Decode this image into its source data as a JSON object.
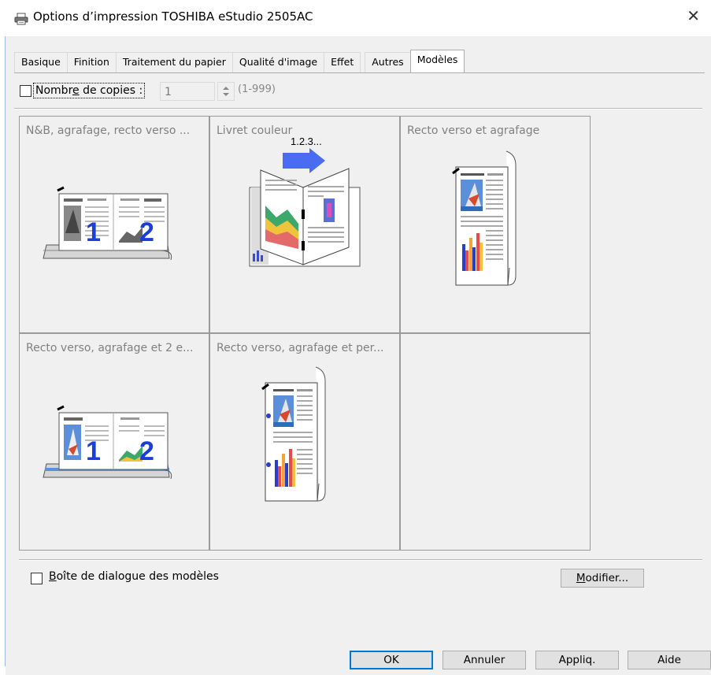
{
  "window": {
    "title": "Options d’impression TOSHIBA eStudio 2505AC",
    "close_glyph": "✕",
    "icon": "printer-icon"
  },
  "tabs": [
    {
      "label": "Basique",
      "active": false
    },
    {
      "label": "Finition",
      "active": false
    },
    {
      "label": "Traitement du papier",
      "active": false
    },
    {
      "label": "Qualité d'image",
      "active": false
    },
    {
      "label": "Effet",
      "active": false
    },
    {
      "label": "Autres",
      "active": false
    },
    {
      "label": "Modèles",
      "active": true
    }
  ],
  "copies": {
    "label_pre": "Nombr",
    "label_accel": "e",
    "label_post": " de copies :",
    "value": "1",
    "range": "(1-999)",
    "checked": false,
    "enabled": false
  },
  "templates": [
    {
      "label": "N&B, agrafage, recto verso ...",
      "icon": "bw-staple-duplex-icon"
    },
    {
      "label": "Livret couleur",
      "icon": "color-booklet-icon",
      "overlay": "1.2.3..."
    },
    {
      "label": "Recto verso et agrafage",
      "icon": "duplex-staple-icon"
    },
    {
      "label": "Recto verso, agrafage et 2 e...",
      "icon": "duplex-staple-2up-icon"
    },
    {
      "label": "Recto verso, agrafage et per...",
      "icon": "duplex-staple-punch-icon"
    },
    {
      "label": "",
      "icon": ""
    }
  ],
  "templates_dialog": {
    "label_accel": "B",
    "label_post": "oîte de dialogue des modèles",
    "checked": false
  },
  "modify_button": {
    "label_accel": "M",
    "label_post": "odifier..."
  },
  "footer": {
    "ok": "OK",
    "cancel": "Annuler",
    "apply": "Appliq.",
    "help": "Aide"
  },
  "colors": {
    "accent": "#0078d7",
    "panel_bg": "#f0f0f0",
    "tile_border": "#9a9a9a",
    "disabled_text": "#808080"
  }
}
